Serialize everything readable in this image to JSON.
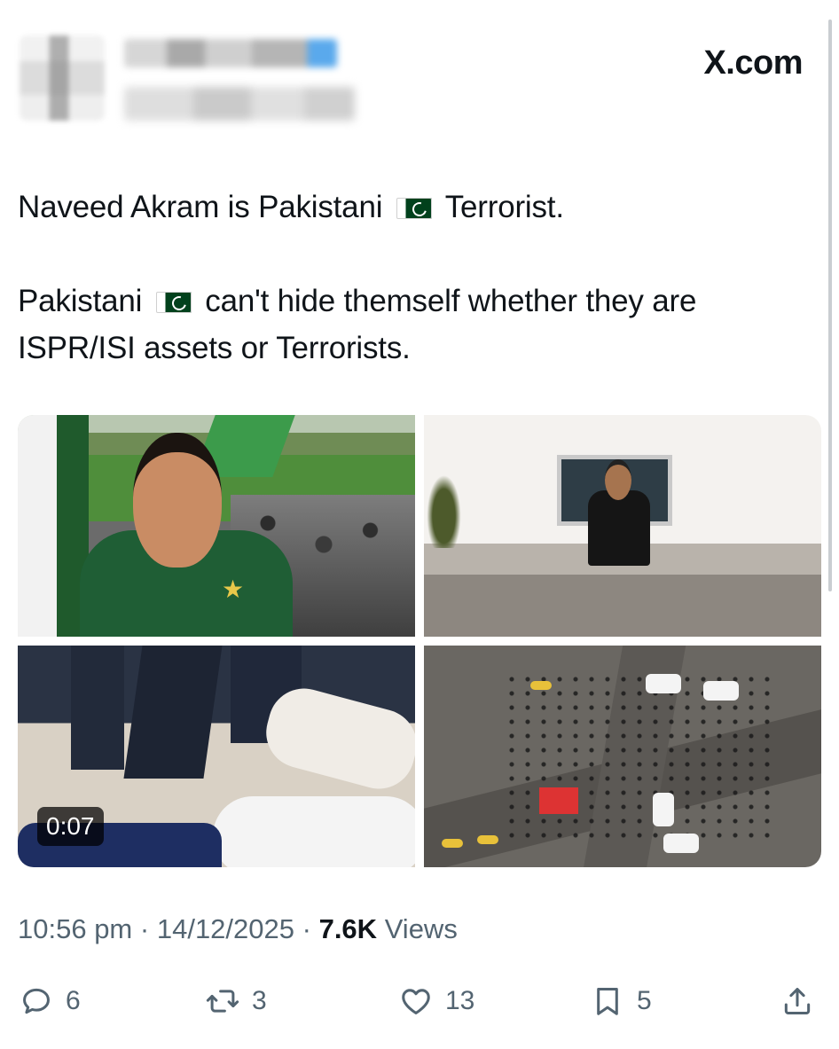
{
  "header": {
    "brand": "X.com",
    "avatar_icon": "avatar-blurred",
    "name_hidden": true
  },
  "post": {
    "line1_before_flag": "Naveed Akram is Pakistani",
    "line1_flag_icon": "pakistan-flag-emoji",
    "line1_after_flag": "Terrorist.",
    "line2_before_flag": "Pakistani",
    "line2_flag_icon": "pakistan-flag-emoji",
    "line2_after_flag": "can't hide themself whether they are ISPR/ISI assets or Terrorists."
  },
  "media": {
    "items": [
      {
        "type": "photo",
        "subject": "stadium-fan-photo"
      },
      {
        "type": "photo",
        "subject": "rooftop-man-photo"
      },
      {
        "type": "video",
        "subject": "arrest-video",
        "duration": "0:07"
      },
      {
        "type": "photo",
        "subject": "aerial-scene-photo"
      }
    ]
  },
  "meta": {
    "time": "10:56 pm",
    "separator": "·",
    "date": "14/12/2025",
    "views_count": "7.6K",
    "views_label": "Views"
  },
  "actions": {
    "replies": "6",
    "reposts": "3",
    "likes": "13",
    "bookmarks": "5"
  },
  "colors": {
    "text": "#0f1419",
    "secondary": "#536471",
    "background": "#ffffff"
  }
}
